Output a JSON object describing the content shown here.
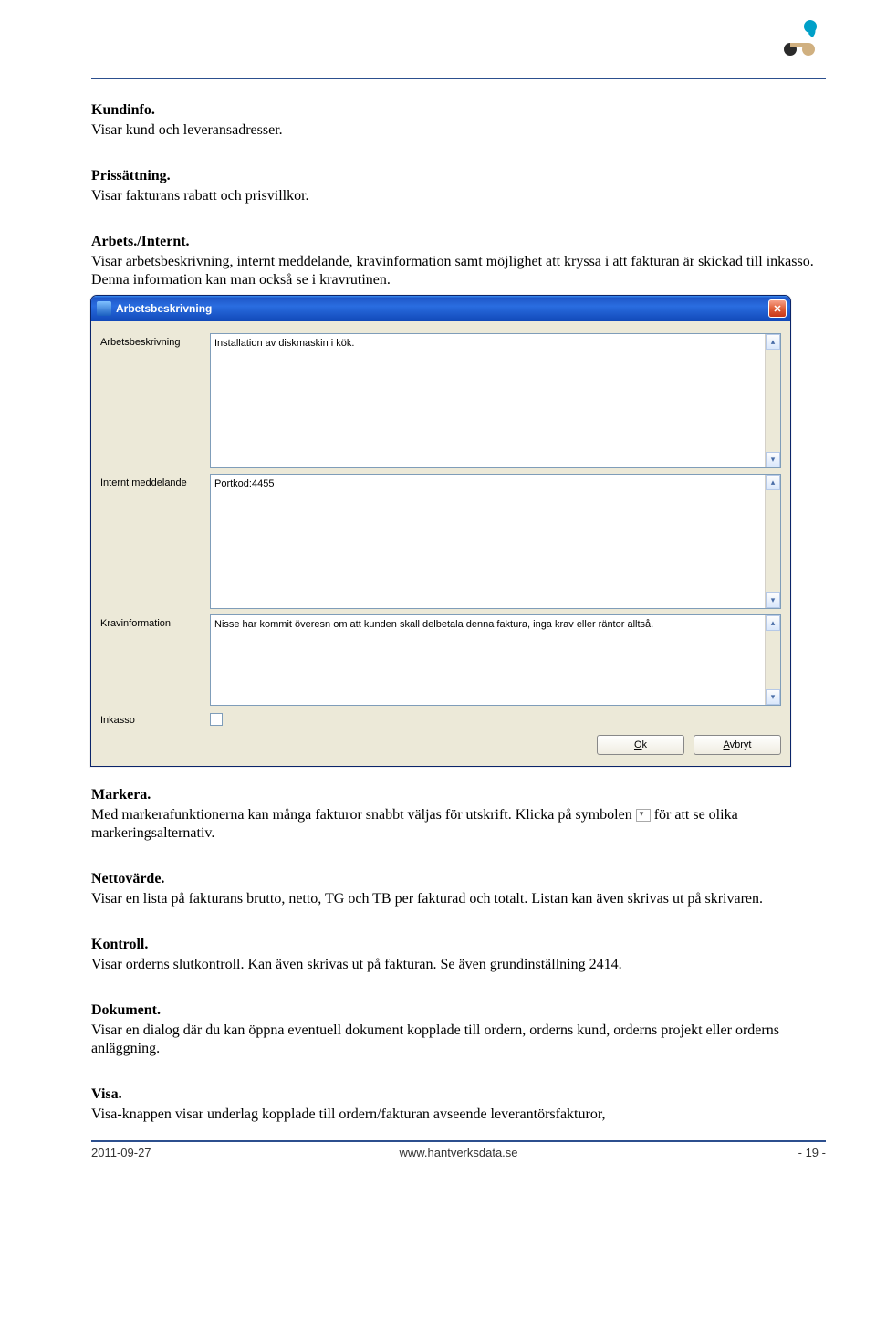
{
  "sections": {
    "kundinfo": {
      "title": "Kundinfo.",
      "text": "Visar kund och leveransadresser."
    },
    "prissattning": {
      "title": "Prissättning.",
      "text": "Visar fakturans rabatt och prisvillkor."
    },
    "arbets": {
      "title": "Arbets./Internt.",
      "text": "Visar arbetsbeskrivning, internt meddelande, kravinformation samt möjlighet att kryssa i att fakturan är skickad till inkasso. Denna information kan man också se i kravrutinen."
    },
    "markera": {
      "title": "Markera.",
      "text1": "Med markerafunktionerna kan många fakturor snabbt väljas för utskrift. Klicka på symbolen",
      "text2": "för att se olika markeringsalternativ."
    },
    "nettovarde": {
      "title": "Nettovärde.",
      "text": "Visar en lista på fakturans brutto, netto, TG och TB per fakturad och totalt. Listan kan även skrivas ut på skrivaren."
    },
    "kontroll": {
      "title": "Kontroll.",
      "text": "Visar orderns slutkontroll. Kan även skrivas ut på fakturan. Se även grundinställning 2414."
    },
    "dokument": {
      "title": "Dokument.",
      "text": "Visar en dialog där du kan öppna eventuell dokument kopplade till ordern, orderns kund, orderns projekt eller orderns anläggning."
    },
    "visa": {
      "title": "Visa.",
      "text": "Visa-knappen visar underlag kopplade till ordern/fakturan avseende leverantörsfakturor,"
    }
  },
  "window": {
    "title": "Arbetsbeskrivning",
    "fields": {
      "arb": {
        "label": "Arbetsbeskrivning",
        "value": "Installation av diskmaskin i kök."
      },
      "internt": {
        "label": "Internt meddelande",
        "value": "Portkod:4455"
      },
      "krav": {
        "label": "Kravinformation",
        "value": "Nisse har kommit överesn om att kunden skall delbetala denna faktura, inga krav eller räntor alltså."
      },
      "inkasso": {
        "label": "Inkasso"
      }
    },
    "buttons": {
      "ok": "Ok",
      "cancel": "Avbryt"
    }
  },
  "footer": {
    "date": "2011-09-27",
    "url": "www.hantverksdata.se",
    "page": "- 19 -"
  }
}
